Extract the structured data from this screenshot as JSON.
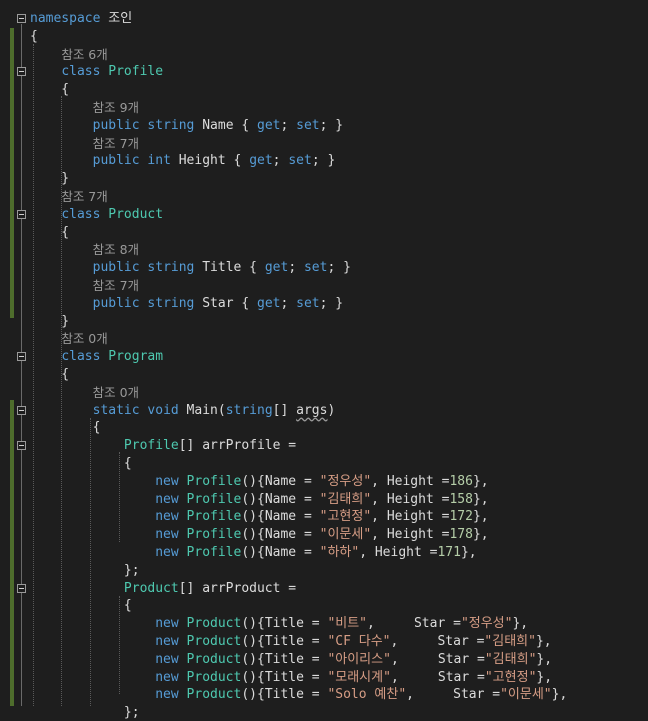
{
  "lines": [
    {
      "tokens": [
        [
          "kw",
          "namespace"
        ],
        [
          "pl",
          " "
        ],
        [
          "ns",
          "조인"
        ]
      ],
      "fold": true
    },
    {
      "tokens": [
        [
          "pl",
          "{"
        ]
      ]
    },
    {
      "tokens": [
        [
          "pl",
          "    "
        ],
        [
          "ref",
          "참조 6개"
        ]
      ]
    },
    {
      "tokens": [
        [
          "pl",
          "    "
        ],
        [
          "kw",
          "class"
        ],
        [
          "pl",
          " "
        ],
        [
          "ty",
          "Profile"
        ]
      ],
      "fold": true
    },
    {
      "tokens": [
        [
          "pl",
          "    {"
        ]
      ]
    },
    {
      "tokens": [
        [
          "pl",
          "        "
        ],
        [
          "ref",
          "참조 9개"
        ]
      ]
    },
    {
      "tokens": [
        [
          "pl",
          "        "
        ],
        [
          "kw",
          "public"
        ],
        [
          "pl",
          " "
        ],
        [
          "kw",
          "string"
        ],
        [
          "pl",
          " Name { "
        ],
        [
          "kw",
          "get"
        ],
        [
          "pl",
          "; "
        ],
        [
          "kw",
          "set"
        ],
        [
          "pl",
          "; }"
        ]
      ]
    },
    {
      "tokens": [
        [
          "pl",
          "        "
        ],
        [
          "ref",
          "참조 7개"
        ]
      ]
    },
    {
      "tokens": [
        [
          "pl",
          "        "
        ],
        [
          "kw",
          "public"
        ],
        [
          "pl",
          " "
        ],
        [
          "kw",
          "int"
        ],
        [
          "pl",
          " Height { "
        ],
        [
          "kw",
          "get"
        ],
        [
          "pl",
          "; "
        ],
        [
          "kw",
          "set"
        ],
        [
          "pl",
          "; }"
        ]
      ]
    },
    {
      "tokens": [
        [
          "pl",
          "    }"
        ]
      ]
    },
    {
      "tokens": [
        [
          "pl",
          "    "
        ],
        [
          "ref",
          "참조 7개"
        ]
      ]
    },
    {
      "tokens": [
        [
          "pl",
          "    "
        ],
        [
          "kw",
          "class"
        ],
        [
          "pl",
          " "
        ],
        [
          "ty",
          "Product"
        ]
      ],
      "fold": true
    },
    {
      "tokens": [
        [
          "pl",
          "    {"
        ]
      ]
    },
    {
      "tokens": [
        [
          "pl",
          "        "
        ],
        [
          "ref",
          "참조 8개"
        ]
      ]
    },
    {
      "tokens": [
        [
          "pl",
          "        "
        ],
        [
          "kw",
          "public"
        ],
        [
          "pl",
          " "
        ],
        [
          "kw",
          "string"
        ],
        [
          "pl",
          " Title { "
        ],
        [
          "kw",
          "get"
        ],
        [
          "pl",
          "; "
        ],
        [
          "kw",
          "set"
        ],
        [
          "pl",
          "; }"
        ]
      ]
    },
    {
      "tokens": [
        [
          "pl",
          "        "
        ],
        [
          "ref",
          "참조 7개"
        ]
      ]
    },
    {
      "tokens": [
        [
          "pl",
          "        "
        ],
        [
          "kw",
          "public"
        ],
        [
          "pl",
          " "
        ],
        [
          "kw",
          "string"
        ],
        [
          "pl",
          " Star { "
        ],
        [
          "kw",
          "get"
        ],
        [
          "pl",
          "; "
        ],
        [
          "kw",
          "set"
        ],
        [
          "pl",
          "; }"
        ]
      ]
    },
    {
      "tokens": [
        [
          "pl",
          "    }"
        ]
      ]
    },
    {
      "tokens": [
        [
          "pl",
          "    "
        ],
        [
          "ref",
          "참조 0개"
        ]
      ]
    },
    {
      "tokens": [
        [
          "pl",
          "    "
        ],
        [
          "kw",
          "class"
        ],
        [
          "pl",
          " "
        ],
        [
          "ty",
          "Program"
        ]
      ],
      "fold": true
    },
    {
      "tokens": [
        [
          "pl",
          "    {"
        ]
      ]
    },
    {
      "tokens": [
        [
          "pl",
          "        "
        ],
        [
          "ref",
          "참조 0개"
        ]
      ]
    },
    {
      "tokens": [
        [
          "pl",
          "        "
        ],
        [
          "kw",
          "static"
        ],
        [
          "pl",
          " "
        ],
        [
          "kw",
          "void"
        ],
        [
          "pl",
          " Main("
        ],
        [
          "kw",
          "string"
        ],
        [
          "pl",
          "[] "
        ],
        [
          "sq",
          "args"
        ],
        [
          "pl",
          ")"
        ]
      ],
      "fold": true
    },
    {
      "tokens": [
        [
          "pl",
          "        {"
        ]
      ]
    },
    {
      "tokens": [
        [
          "pl",
          "            "
        ],
        [
          "ty",
          "Profile"
        ],
        [
          "pl",
          "[] arrProfile ="
        ]
      ],
      "fold": true
    },
    {
      "tokens": [
        [
          "pl",
          "            {"
        ]
      ]
    },
    {
      "tokens": [
        [
          "pl",
          "                "
        ],
        [
          "kw",
          "new"
        ],
        [
          "pl",
          " "
        ],
        [
          "ty",
          "Profile"
        ],
        [
          "pl",
          "(){Name = "
        ],
        [
          "st",
          "\"정우성\""
        ],
        [
          "pl",
          ", Height ="
        ],
        [
          "nu",
          "186"
        ],
        [
          "pl",
          "},"
        ]
      ]
    },
    {
      "tokens": [
        [
          "pl",
          "                "
        ],
        [
          "kw",
          "new"
        ],
        [
          "pl",
          " "
        ],
        [
          "ty",
          "Profile"
        ],
        [
          "pl",
          "(){Name = "
        ],
        [
          "st",
          "\"김태희\""
        ],
        [
          "pl",
          ", Height ="
        ],
        [
          "nu",
          "158"
        ],
        [
          "pl",
          "},"
        ]
      ]
    },
    {
      "tokens": [
        [
          "pl",
          "                "
        ],
        [
          "kw",
          "new"
        ],
        [
          "pl",
          " "
        ],
        [
          "ty",
          "Profile"
        ],
        [
          "pl",
          "(){Name = "
        ],
        [
          "st",
          "\"고현정\""
        ],
        [
          "pl",
          ", Height ="
        ],
        [
          "nu",
          "172"
        ],
        [
          "pl",
          "},"
        ]
      ]
    },
    {
      "tokens": [
        [
          "pl",
          "                "
        ],
        [
          "kw",
          "new"
        ],
        [
          "pl",
          " "
        ],
        [
          "ty",
          "Profile"
        ],
        [
          "pl",
          "(){Name = "
        ],
        [
          "st",
          "\"이문세\""
        ],
        [
          "pl",
          ", Height ="
        ],
        [
          "nu",
          "178"
        ],
        [
          "pl",
          "},"
        ]
      ]
    },
    {
      "tokens": [
        [
          "pl",
          "                "
        ],
        [
          "kw",
          "new"
        ],
        [
          "pl",
          " "
        ],
        [
          "ty",
          "Profile"
        ],
        [
          "pl",
          "(){Name = "
        ],
        [
          "st",
          "\"하하\""
        ],
        [
          "pl",
          ", Height ="
        ],
        [
          "nu",
          "171"
        ],
        [
          "pl",
          "},"
        ]
      ]
    },
    {
      "tokens": [
        [
          "pl",
          "            };"
        ]
      ]
    },
    {
      "tokens": [
        [
          "pl",
          "            "
        ],
        [
          "ty",
          "Product"
        ],
        [
          "pl",
          "[] arrProduct ="
        ]
      ],
      "fold": true
    },
    {
      "tokens": [
        [
          "pl",
          "            {"
        ]
      ]
    },
    {
      "tokens": [
        [
          "pl",
          "                "
        ],
        [
          "kw",
          "new"
        ],
        [
          "pl",
          " "
        ],
        [
          "ty",
          "Product"
        ],
        [
          "pl",
          "(){Title = "
        ],
        [
          "st",
          "\"비트\""
        ],
        [
          "pl",
          ",     Star ="
        ],
        [
          "st",
          "\"정우성\""
        ],
        [
          "pl",
          "},"
        ]
      ]
    },
    {
      "tokens": [
        [
          "pl",
          "                "
        ],
        [
          "kw",
          "new"
        ],
        [
          "pl",
          " "
        ],
        [
          "ty",
          "Product"
        ],
        [
          "pl",
          "(){Title = "
        ],
        [
          "st",
          "\"CF 다수\""
        ],
        [
          "pl",
          ",     Star ="
        ],
        [
          "st",
          "\"김태희\""
        ],
        [
          "pl",
          "},"
        ]
      ]
    },
    {
      "tokens": [
        [
          "pl",
          "                "
        ],
        [
          "kw",
          "new"
        ],
        [
          "pl",
          " "
        ],
        [
          "ty",
          "Product"
        ],
        [
          "pl",
          "(){Title = "
        ],
        [
          "st",
          "\"아이리스\""
        ],
        [
          "pl",
          ",     Star ="
        ],
        [
          "st",
          "\"김태희\""
        ],
        [
          "pl",
          "},"
        ]
      ]
    },
    {
      "tokens": [
        [
          "pl",
          "                "
        ],
        [
          "kw",
          "new"
        ],
        [
          "pl",
          " "
        ],
        [
          "ty",
          "Product"
        ],
        [
          "pl",
          "(){Title = "
        ],
        [
          "st",
          "\"모래시계\""
        ],
        [
          "pl",
          ",     Star ="
        ],
        [
          "st",
          "\"고현정\""
        ],
        [
          "pl",
          "},"
        ]
      ]
    },
    {
      "tokens": [
        [
          "pl",
          "                "
        ],
        [
          "kw",
          "new"
        ],
        [
          "pl",
          " "
        ],
        [
          "ty",
          "Product"
        ],
        [
          "pl",
          "(){Title = "
        ],
        [
          "st",
          "\"Solo 예찬\""
        ],
        [
          "pl",
          ",     Star ="
        ],
        [
          "st",
          "\"이문세\""
        ],
        [
          "pl",
          "},"
        ]
      ]
    },
    {
      "tokens": [
        [
          "pl",
          "            };"
        ]
      ]
    }
  ]
}
